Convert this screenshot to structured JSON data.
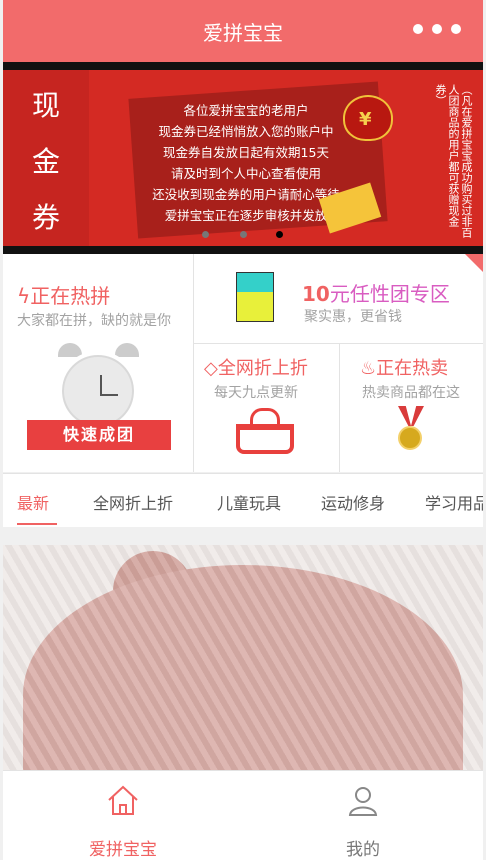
{
  "app_title": "爱拼宝宝",
  "banner": {
    "left_text": [
      "现",
      "金",
      "券"
    ],
    "notice": [
      "各位爱拼宝宝的老用户",
      "现金券已经悄悄放入您的账户中",
      "现金券自发放日起有效期15天",
      "请及时到个人中心查看使用",
      "还没收到现金券的用户请耐心等待",
      "爱拼宝宝正在逐步审核并发放"
    ],
    "vertical_note": "（凡在爱拼宝宝成功购买过非百人团商品的用户都可获赠现金券）"
  },
  "grid": {
    "hot": {
      "title": "正在热拼",
      "subtitle": "大家都在拼，缺的就是你",
      "badge": "快速成团"
    },
    "ten": {
      "title_num": "10",
      "title_text": "元任性团专区",
      "subtitle": "聚实惠，更省钱"
    },
    "discount": {
      "title": "全网折上折",
      "subtitle": "每天九点更新"
    },
    "sale": {
      "title": "正在热卖",
      "subtitle": "热卖商品都在这"
    }
  },
  "tabs": [
    "最新",
    "全网折上折",
    "儿童玩具",
    "运动修身",
    "学习用品"
  ],
  "bottom_nav": {
    "home": "爱拼宝宝",
    "me": "我的"
  },
  "colors": {
    "accent": "#f06262",
    "header": "#f26b6b"
  }
}
